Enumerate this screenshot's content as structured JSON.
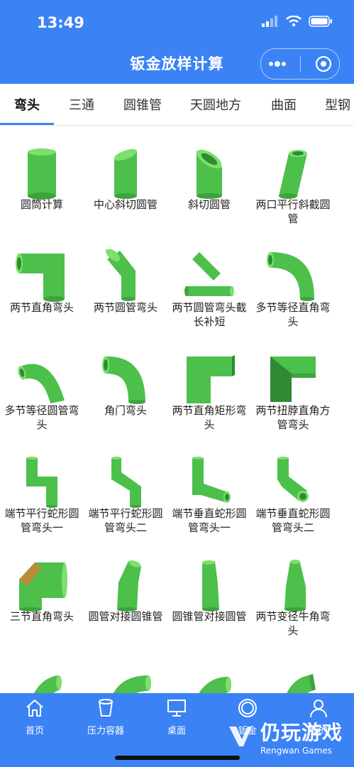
{
  "status_bar": {
    "time": "13:49"
  },
  "header": {
    "title": "钣金放样计算"
  },
  "tabs": [
    {
      "label": "弯头"
    },
    {
      "label": "三通"
    },
    {
      "label": "圆锥管"
    },
    {
      "label": "天圆地方"
    },
    {
      "label": "曲面"
    },
    {
      "label": "型钢"
    }
  ],
  "active_tab": "弯头",
  "items": [
    {
      "label": "圆筒计算",
      "icon": "cylinder-icon"
    },
    {
      "label": "中心斜切圆管",
      "icon": "center-bevel-pipe-icon"
    },
    {
      "label": "斜切圆管",
      "icon": "bevel-pipe-icon"
    },
    {
      "label": "两口平行斜截圆管",
      "icon": "parallel-bevel-pipe-icon"
    },
    {
      "label": "两节直角弯头",
      "icon": "two-section-right-elbow-icon"
    },
    {
      "label": "两节圆管弯头",
      "icon": "two-section-pipe-elbow-icon"
    },
    {
      "label": "两节圆管弯头截长补短",
      "icon": "cut-and-fill-elbow-icon"
    },
    {
      "label": "多节等径直角弯头",
      "icon": "multi-section-right-elbow-icon"
    },
    {
      "label": "多节等径圆管弯头",
      "icon": "multi-section-pipe-elbow-icon"
    },
    {
      "label": "角门弯头",
      "icon": "corner-elbow-icon"
    },
    {
      "label": "两节直角矩形弯头",
      "icon": "rect-right-elbow-icon"
    },
    {
      "label": "两节扭脖直角方管弯头",
      "icon": "twisted-square-elbow-icon"
    },
    {
      "label": "端节平行蛇形圆管弯头一",
      "icon": "parallel-snake-elbow-1-icon"
    },
    {
      "label": "端节平行蛇形圆管弯头二",
      "icon": "parallel-snake-elbow-2-icon"
    },
    {
      "label": "端节垂直蛇形圆管弯头一",
      "icon": "vertical-snake-elbow-1-icon"
    },
    {
      "label": "端节垂直蛇形圆管弯头二",
      "icon": "vertical-snake-elbow-2-icon"
    },
    {
      "label": "三节直角弯头",
      "icon": "three-section-right-elbow-icon"
    },
    {
      "label": "圆管对接圆锥管",
      "icon": "pipe-to-cone-icon"
    },
    {
      "label": "圆锥管对接圆管",
      "icon": "cone-to-pipe-icon"
    },
    {
      "label": "两节变径牛角弯头",
      "icon": "reducing-horn-elbow-icon"
    },
    {
      "label": "",
      "icon": "curved-elbow-a-icon"
    },
    {
      "label": "",
      "icon": "curved-elbow-b-icon"
    },
    {
      "label": "",
      "icon": "curved-elbow-c-icon"
    },
    {
      "label": "",
      "icon": "rect-curved-elbow-icon"
    }
  ],
  "bottom_nav": [
    {
      "label": "首页",
      "icon": "home-icon"
    },
    {
      "label": "压力容器",
      "icon": "vessel-icon"
    },
    {
      "label": "桌面",
      "icon": "monitor-icon"
    },
    {
      "label": "钣金",
      "icon": "circle-icon"
    },
    {
      "label": "我的",
      "icon": "user-icon"
    }
  ],
  "watermark": {
    "cn": "仍玩游戏",
    "en": "Rengwan Games"
  },
  "colors": {
    "primary": "#3b82f5",
    "shape": "#4cc04a",
    "shape_dark": "#2f8a31",
    "shape_light": "#7ddf6e"
  }
}
